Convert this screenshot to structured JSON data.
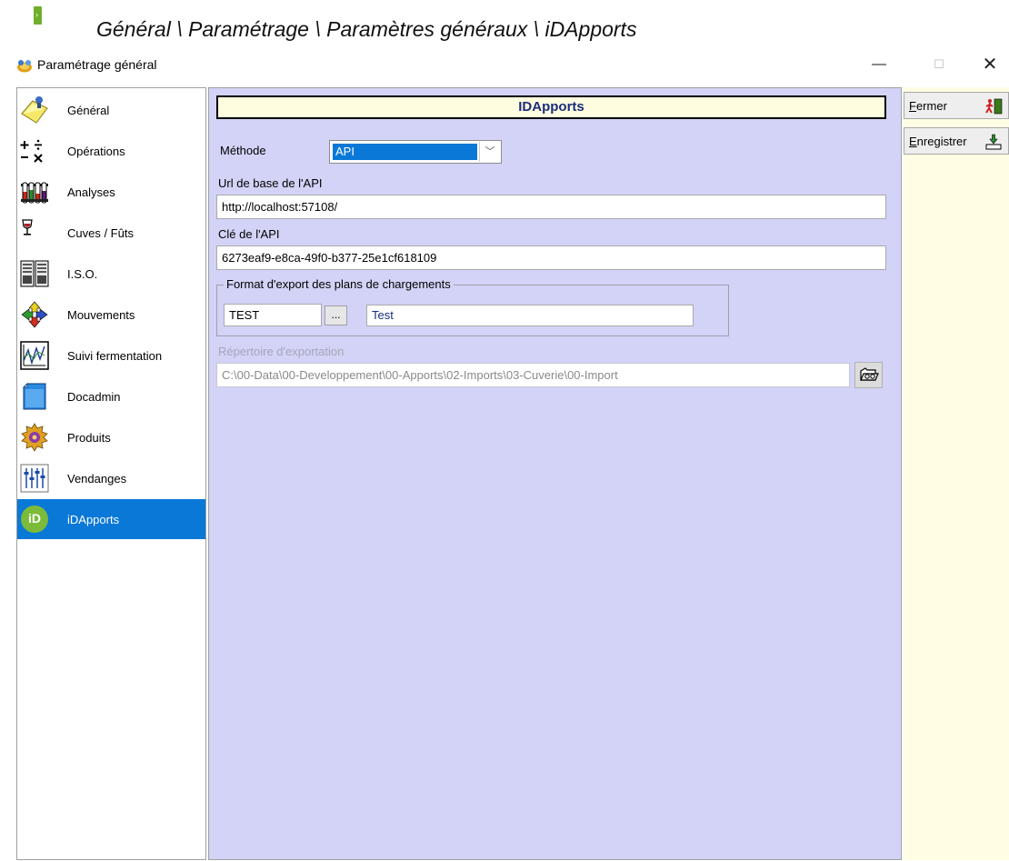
{
  "breadcrumb": "Général \\ Paramétrage \\ Paramètres généraux \\ iDApports",
  "window": {
    "title": "Paramétrage général",
    "minimize": "—",
    "maximize": "☐",
    "close": "✕"
  },
  "nav": {
    "selected": "iDApports",
    "items": [
      {
        "label": "Général",
        "icon": "notepad-icon"
      },
      {
        "label": "Opérations",
        "icon": "math-operations-icon"
      },
      {
        "label": "Analyses",
        "icon": "test-tubes-icon"
      },
      {
        "label": "Cuves / Fûts",
        "icon": "wine-glass-icon"
      },
      {
        "label": "I.S.O.",
        "icon": "iso-document-icon"
      },
      {
        "label": "Mouvements",
        "icon": "arrows-icon"
      },
      {
        "label": "Suivi fermentation",
        "icon": "chart-icon"
      },
      {
        "label": "Docadmin",
        "icon": "document-icon"
      },
      {
        "label": "Produits",
        "icon": "gear-icon"
      },
      {
        "label": "Vendanges",
        "icon": "sliders-icon"
      },
      {
        "label": "iDApports",
        "icon": "idapports-logo-icon"
      }
    ]
  },
  "panel": {
    "title": "IDApports",
    "method_label": "Méthode",
    "method_value": "API",
    "method_arrow": "﹀",
    "url_label": "Url de base de l'API",
    "url_value": "http://localhost:57108/",
    "key_label": "Clé de l'API",
    "key_value": "6273eaf9-e8ca-49f0-b377-25e1cf618109",
    "export_group_title": "Format d'export des plans de chargements",
    "export_code": "TEST",
    "export_browse": "...",
    "export_name": "Test",
    "dir_label": "Répertoire d'exportation",
    "dir_value": "C:\\00-Data\\00-Developpement\\00-Apports\\02-Imports\\03-Cuverie\\00-Import"
  },
  "commands": {
    "close_label": "Fermer",
    "save_label": "Enregistrer"
  },
  "logo_text": "iD"
}
